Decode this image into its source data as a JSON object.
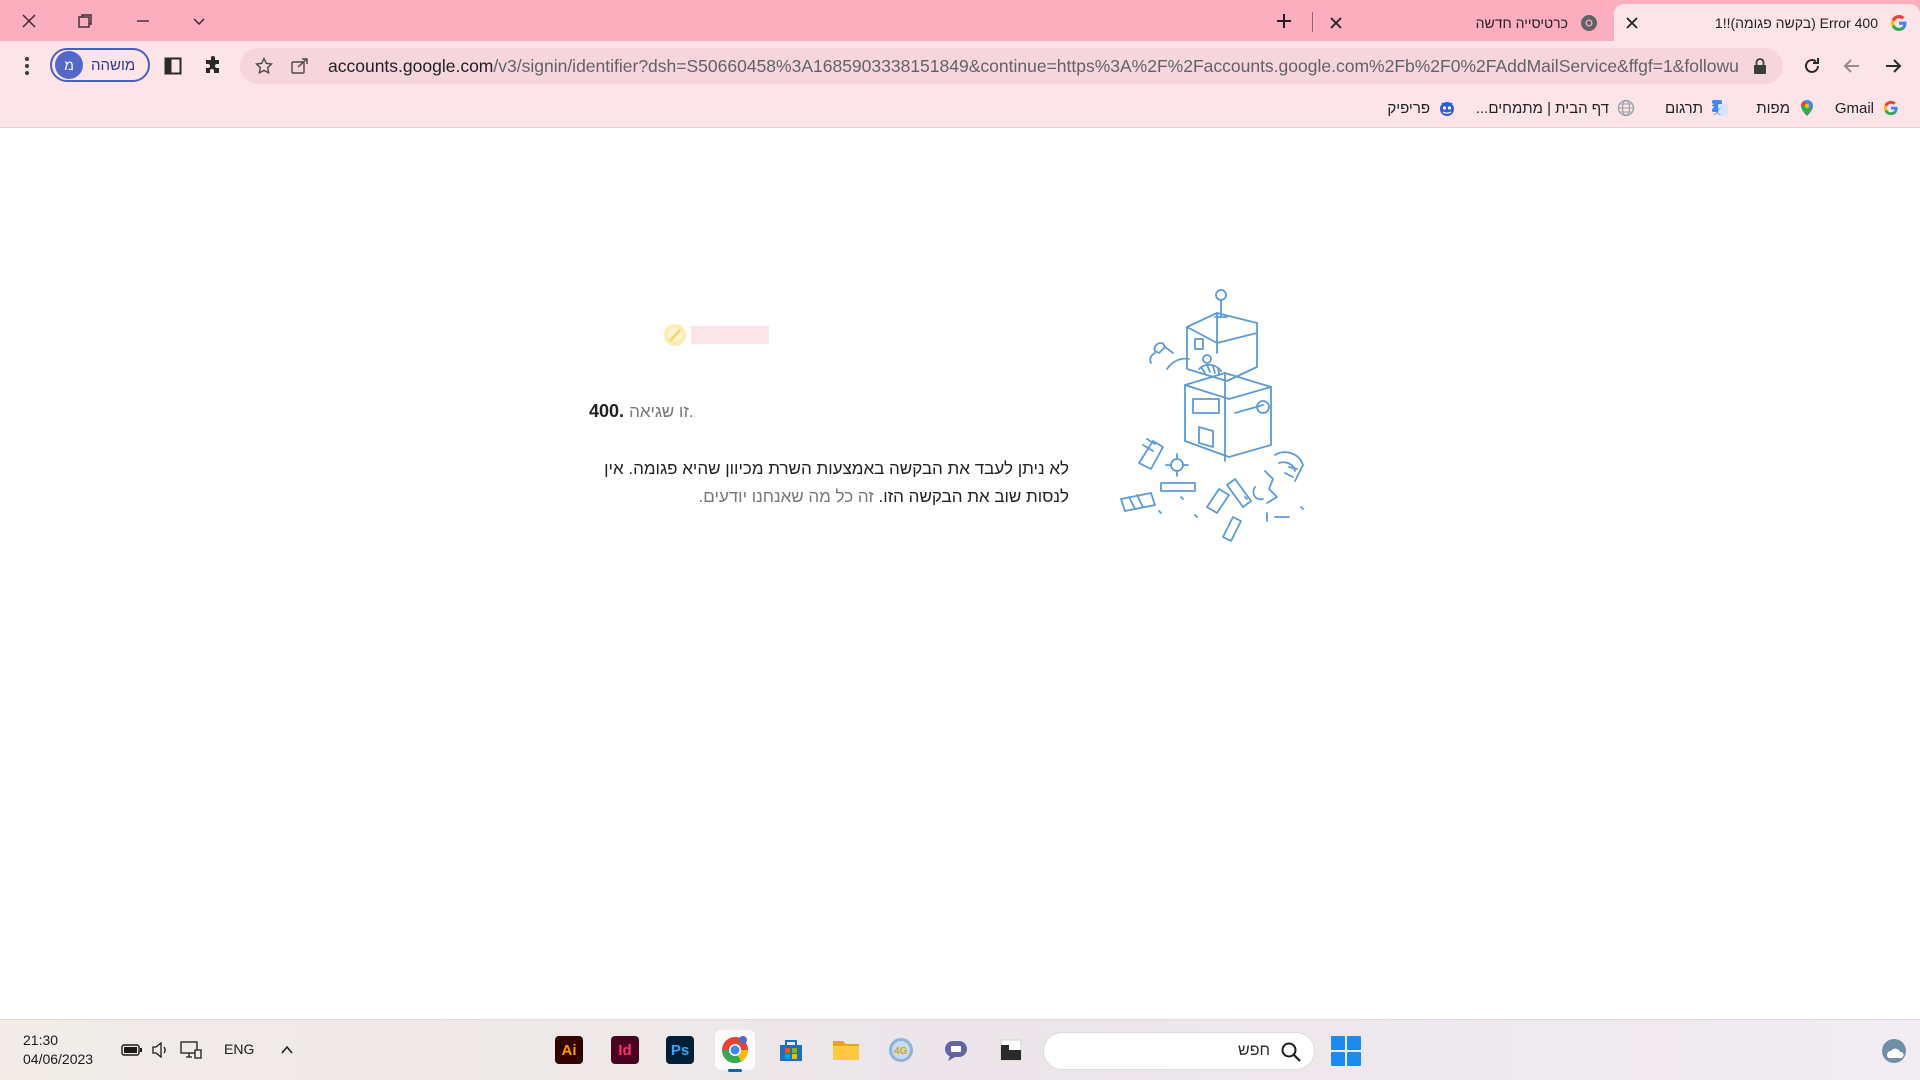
{
  "browser": {
    "tabs": [
      {
        "title": "Error 400 (בקשה פגומה)!!1",
        "active": true
      },
      {
        "title": "כרטיסייה חדשה",
        "active": false
      }
    ],
    "url_host": "accounts.google.com",
    "url_path": "/v3/signin/identifier?dsh=S50660458%3A1685903338151849&continue=https%3A%2F%2Faccounts.google.com%2Fb%2F0%2FAddMailService&ffgf=1&followu...",
    "profile": {
      "initial": "מ",
      "label": "מושהה"
    },
    "bookmarks": [
      {
        "label": "Gmail",
        "icon": "google-icon"
      },
      {
        "label": "מפות",
        "icon": "maps-icon"
      },
      {
        "label": "תרגום",
        "icon": "translate-icon"
      },
      {
        "label": "דף הבית | מתמחים...",
        "icon": "web-icon"
      },
      {
        "label": "פריפיק",
        "icon": "freepik-icon"
      }
    ]
  },
  "page": {
    "error_code": "400.",
    "error_label": "זו שגיאה.",
    "message_main": "לא ניתן לעבד את הבקשה באמצעות השרת מכיוון שהיא פגומה. אין לנסות שוב את הבקשה הזו.",
    "message_muted": "זה כל מה שאנחנו יודעים."
  },
  "taskbar": {
    "time": "21:30",
    "date": "04/06/2023",
    "language": "ENG",
    "search_placeholder": "חפש",
    "apps": [
      {
        "name": "illustrator",
        "label": "Ai",
        "bg": "#330000",
        "fg": "#ff9a00"
      },
      {
        "name": "indesign",
        "label": "Id",
        "bg": "#49021f",
        "fg": "#ff3366"
      },
      {
        "name": "photoshop",
        "label": "Ps",
        "bg": "#001e36",
        "fg": "#31a8ff"
      }
    ]
  },
  "colors": {
    "tabstrip": "#fcaebe",
    "toolbar": "#fde4e8",
    "profile_accent": "#5468c7",
    "start_blue": "#1a8cf0"
  }
}
